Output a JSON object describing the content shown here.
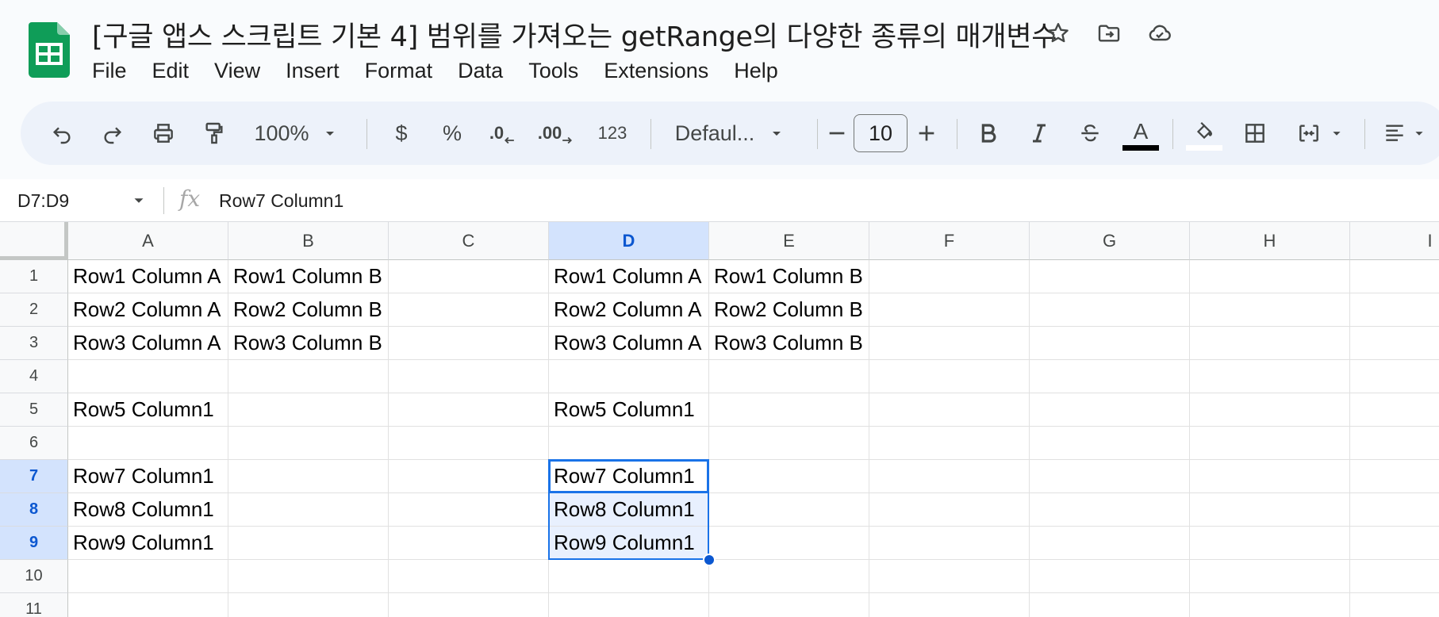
{
  "title": "[구글 앱스 스크립트 기본 4] 범위를 가져오는 getRange의 다양한 종류의 매개변수",
  "menu": [
    "File",
    "Edit",
    "View",
    "Insert",
    "Format",
    "Data",
    "Tools",
    "Extensions",
    "Help"
  ],
  "toolbar": {
    "zoom": "100%",
    "currency": "$",
    "percent": "%",
    "decrease_decimal": ".0",
    "increase_decimal": ".00",
    "number_format": "123",
    "font": "Defaul...",
    "font_size": "10",
    "text_color_label": "A"
  },
  "formula_bar": {
    "name_box": "D7:D9",
    "fx": "fx",
    "content": "Row7 Column1"
  },
  "columns": [
    "A",
    "B",
    "C",
    "D",
    "E",
    "F",
    "G",
    "H",
    "I"
  ],
  "rows": [
    "1",
    "2",
    "3",
    "4",
    "5",
    "6",
    "7",
    "8",
    "9",
    "10",
    "11"
  ],
  "cells": [
    [
      "Row1 Column A",
      "Row1 Column B",
      "",
      "Row1 Column A",
      "Row1 Column B",
      "",
      "",
      "",
      ""
    ],
    [
      "Row2 Column A",
      "Row2 Column B",
      "",
      "Row2 Column A",
      "Row2 Column B",
      "",
      "",
      "",
      ""
    ],
    [
      "Row3 Column A",
      "Row3 Column B",
      "",
      "Row3 Column A",
      "Row3 Column B",
      "",
      "",
      "",
      ""
    ],
    [
      "",
      "",
      "",
      "",
      "",
      "",
      "",
      "",
      ""
    ],
    [
      "Row5 Column1",
      "",
      "",
      "Row5 Column1",
      "",
      "",
      "",
      "",
      ""
    ],
    [
      "",
      "",
      "",
      "",
      "",
      "",
      "",
      "",
      ""
    ],
    [
      "Row7 Column1",
      "",
      "",
      "Row7 Column1",
      "",
      "",
      "",
      "",
      ""
    ],
    [
      "Row8 Column1",
      "",
      "",
      "Row8 Column1",
      "",
      "",
      "",
      "",
      ""
    ],
    [
      "Row9 Column1",
      "",
      "",
      "Row9 Column1",
      "",
      "",
      "",
      "",
      ""
    ],
    [
      "",
      "",
      "",
      "",
      "",
      "",
      "",
      "",
      ""
    ],
    [
      "",
      "",
      "",
      "",
      "",
      "",
      "",
      "",
      ""
    ]
  ],
  "selection": {
    "col": "D",
    "first_row": 7,
    "last_row": 9,
    "active_row": 7
  },
  "colors": {
    "logo_green": "#0f9d58",
    "selection_blue": "#1a73e8",
    "header_selected": "#d3e3fd",
    "toolbar_bg": "#edf2fa"
  },
  "icons": {
    "title": [
      "star-icon",
      "move-to-folder-icon",
      "cloud-saved-icon"
    ],
    "toolbar": [
      "undo-icon",
      "redo-icon",
      "print-icon",
      "paint-format-icon",
      "dropdown-arrow-icon",
      "bold-icon",
      "italic-icon",
      "strikethrough-icon",
      "text-color-icon",
      "fill-color-icon",
      "borders-icon",
      "merge-cells-icon",
      "align-left-icon"
    ]
  }
}
